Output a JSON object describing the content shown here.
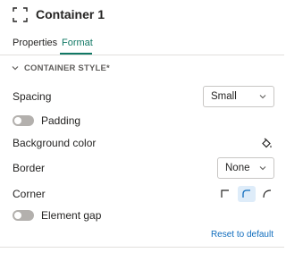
{
  "header": {
    "title": "Container 1",
    "icon": "container-select-icon"
  },
  "tabs": [
    {
      "label": "Properties",
      "active": false
    },
    {
      "label": "Format",
      "active": true
    }
  ],
  "section": {
    "title": "CONTAINER STYLE*",
    "expanded": true
  },
  "spacing": {
    "label": "Spacing",
    "value": "Small"
  },
  "padding": {
    "label": "Padding",
    "on": false
  },
  "background": {
    "label": "Background color",
    "icon": "paint-bucket-icon"
  },
  "border": {
    "label": "Border",
    "value": "None"
  },
  "corner": {
    "label": "Corner",
    "options": [
      "square",
      "rounded",
      "round"
    ],
    "selected": "rounded"
  },
  "element_gap": {
    "label": "Element gap",
    "on": false
  },
  "reset": {
    "label": "Reset to default"
  },
  "colors": {
    "accent": "#117865",
    "link": "#0f6cbd",
    "selected_bg": "#deecf9",
    "toggle_off": "#b3b0ad"
  }
}
